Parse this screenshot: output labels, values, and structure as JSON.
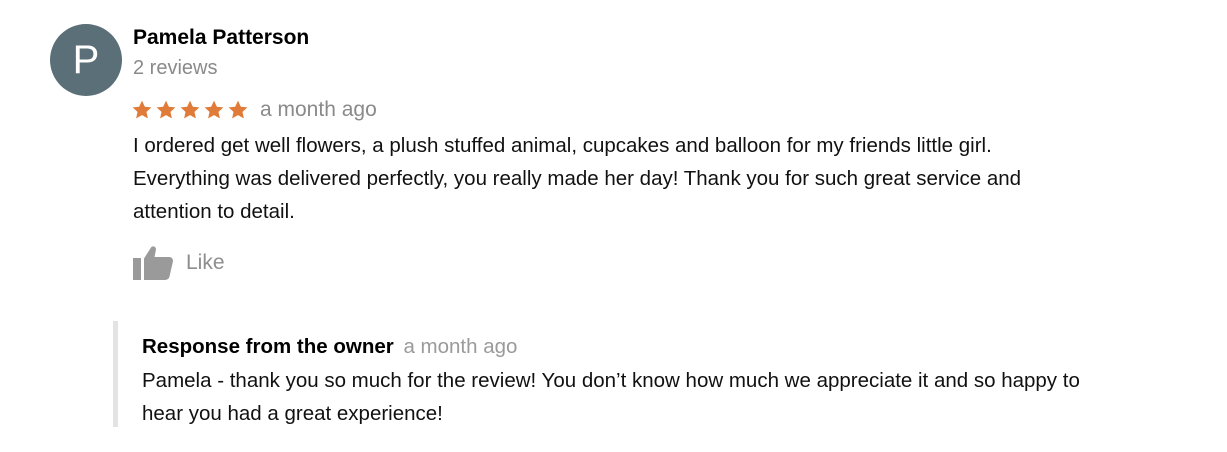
{
  "review": {
    "avatar_initial": "P",
    "author_name": "Pamela Patterson",
    "review_count": "2 reviews",
    "rating": 5,
    "rating_max": 5,
    "star_color": "#e07b39",
    "time": "a month ago",
    "text_lines": [
      "I ordered get well flowers, a plush stuffed animal, cupcakes and balloon for my friends little girl.",
      "Everything was delivered perfectly, you really made her day!  Thank you for such great service and",
      "attention to detail."
    ],
    "like": {
      "icon": "thumbs-up-icon",
      "label": "Like"
    }
  },
  "owner_response": {
    "title": "Response from the owner",
    "time": "a month ago",
    "text_lines": [
      "Pamela - thank you so much for the review! You don’t know how much we appreciate it and so happy to",
      "hear you had a great experience!"
    ]
  },
  "colors": {
    "avatar_bg": "#5a6f78",
    "muted_text": "#8a8a8a",
    "response_border": "#e3e3e3"
  }
}
